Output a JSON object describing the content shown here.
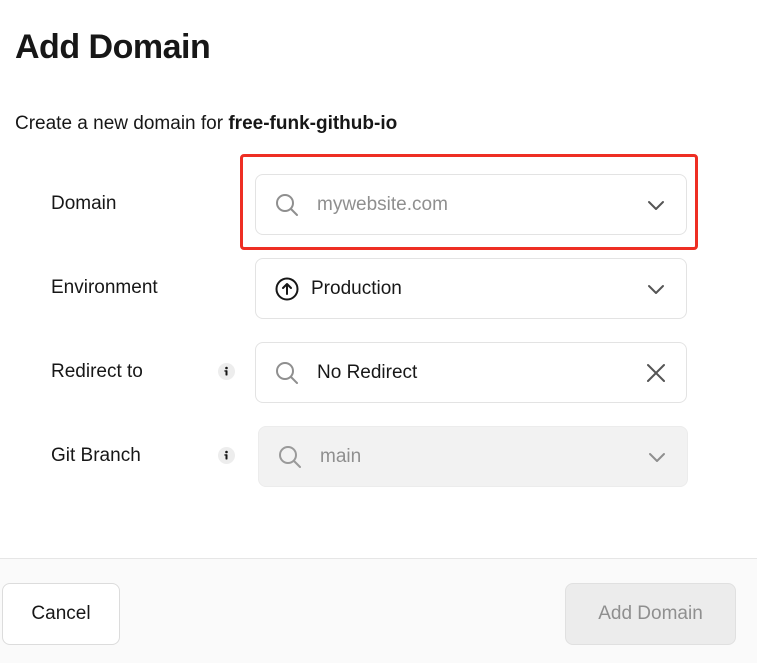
{
  "dialog": {
    "title": "Add Domain",
    "subtitle_prefix": "Create a new domain for ",
    "project_name": "free-funk-github-io"
  },
  "fields": {
    "domain": {
      "label": "Domain",
      "placeholder": "mywebsite.com",
      "lead_icon": "search-icon",
      "trail_icon": "chevron-down-icon"
    },
    "environment": {
      "label": "Environment",
      "value": "Production",
      "lead_icon": "arrow-up-circle-icon",
      "trail_icon": "chevron-down-icon"
    },
    "redirect": {
      "label": "Redirect to",
      "value": "No Redirect",
      "lead_icon": "search-icon",
      "trail_icon": "close-icon",
      "info_icon": "info-icon"
    },
    "git_branch": {
      "label": "Git Branch",
      "value": "main",
      "disabled": true,
      "lead_icon": "search-icon",
      "trail_icon": "chevron-down-icon",
      "info_icon": "info-icon"
    }
  },
  "footer": {
    "cancel_label": "Cancel",
    "submit_label": "Add Domain",
    "submit_disabled": true
  },
  "colors": {
    "highlight_border": "#ee2e23",
    "text": "#171717",
    "muted_text": "#8f8f8f",
    "field_border": "#e3e3e3",
    "disabled_bg": "#f2f2f2"
  }
}
